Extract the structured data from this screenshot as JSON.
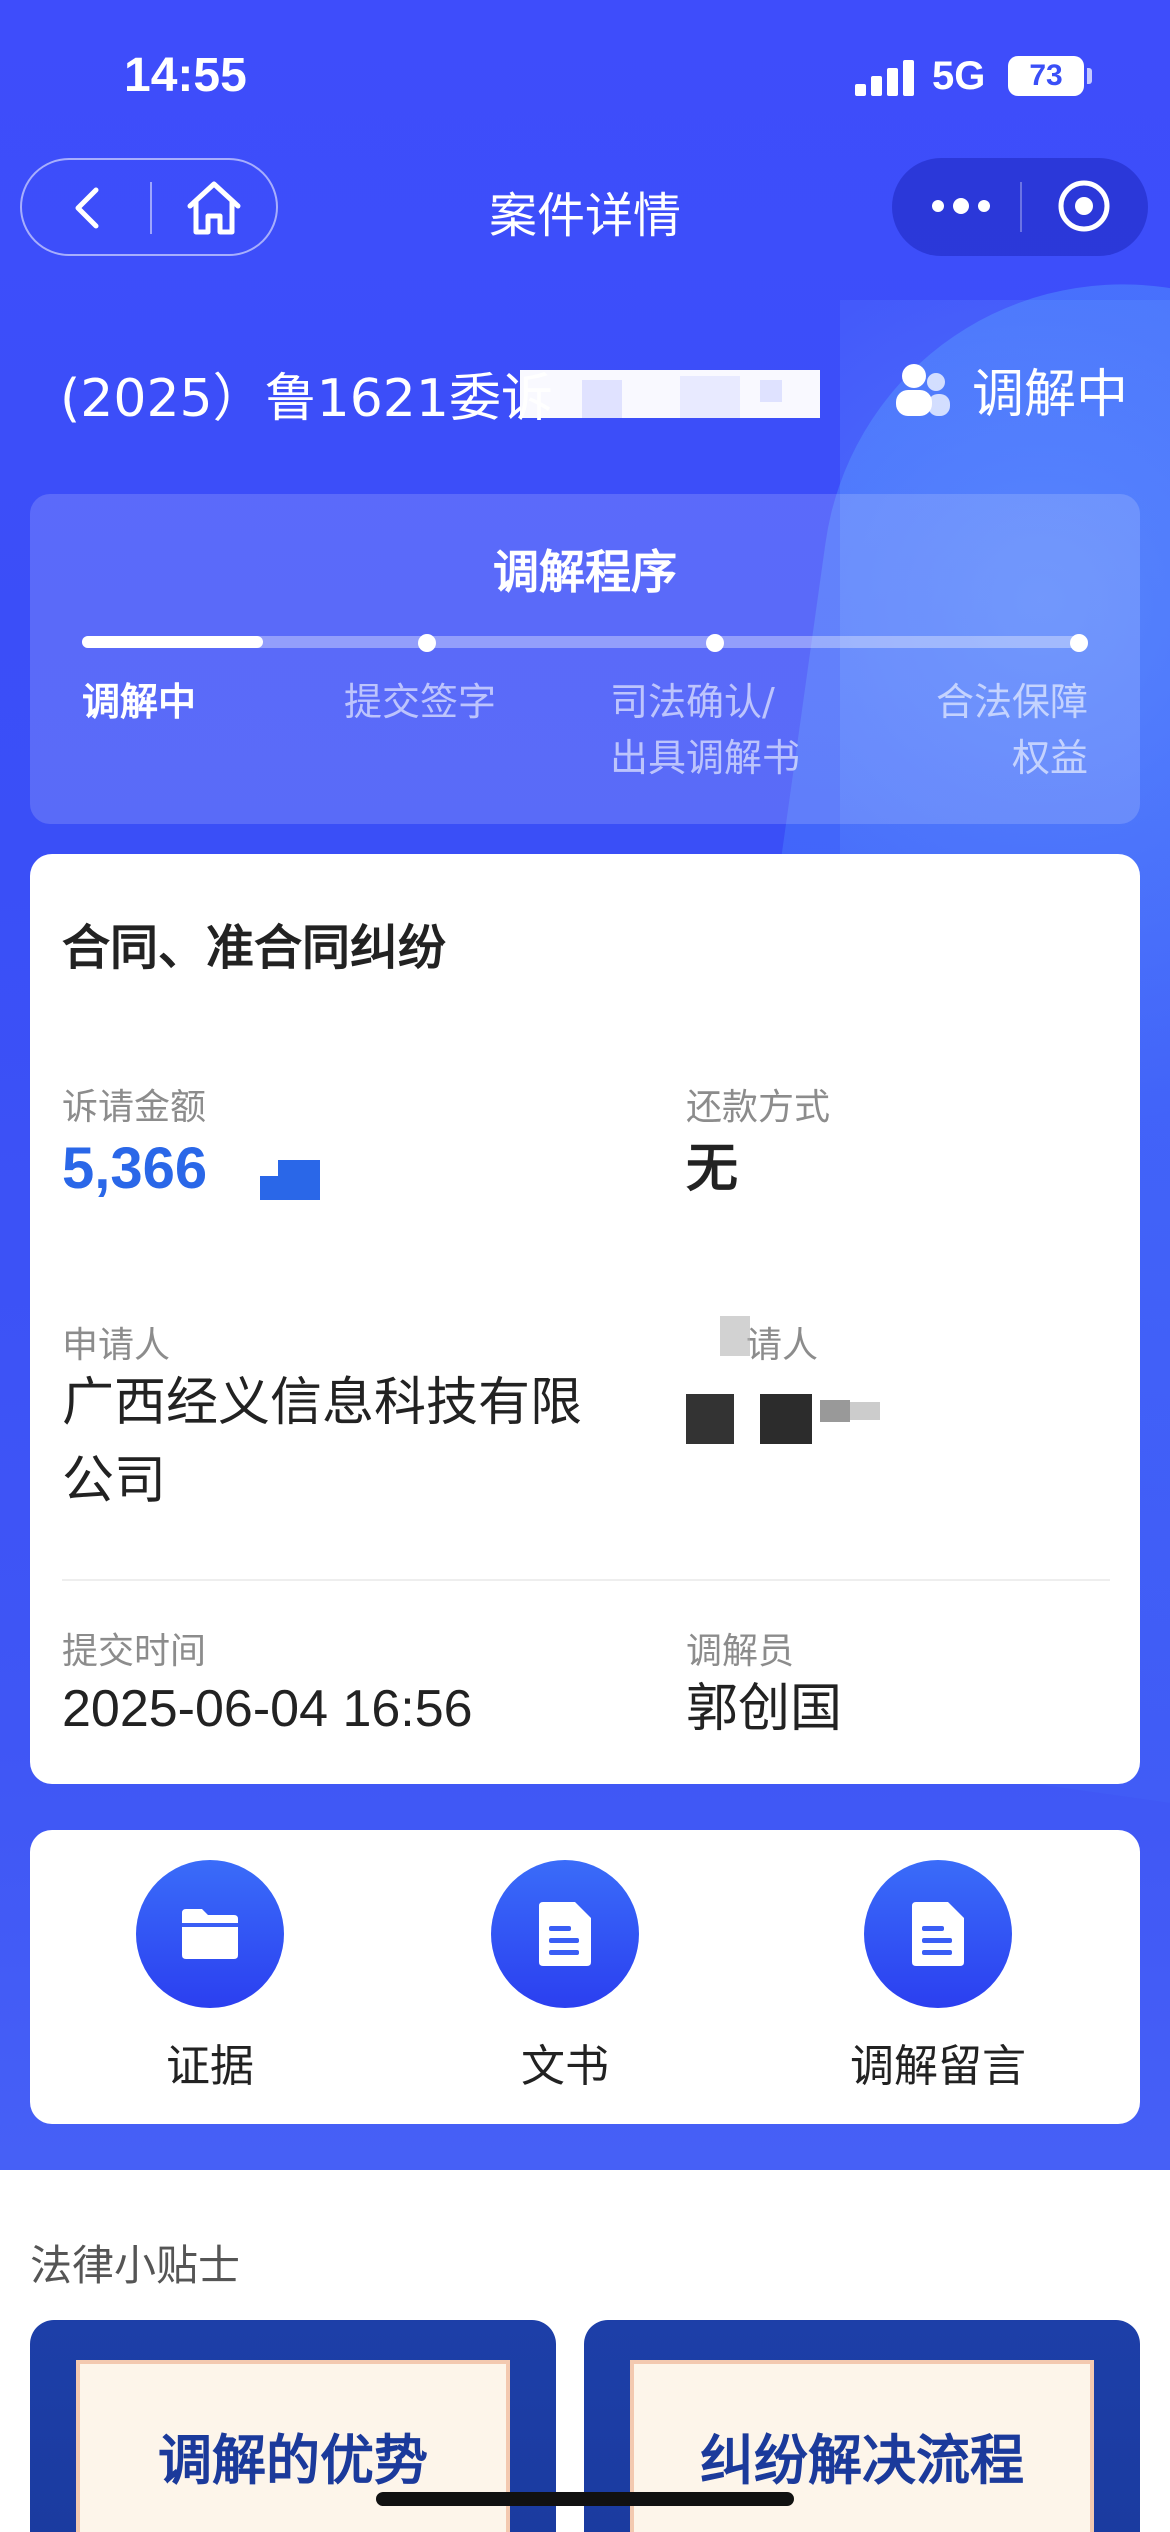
{
  "status_bar": {
    "time": "14:55",
    "network": "5G",
    "battery": "73"
  },
  "nav": {
    "title": "案件详情"
  },
  "case": {
    "number": "(2025）鲁1621委诉",
    "status": "调解中"
  },
  "process": {
    "title": "调解程序",
    "progress": 0.18,
    "steps": [
      {
        "line1": "调解中",
        "line2": ""
      },
      {
        "line1": "提交签字",
        "line2": ""
      },
      {
        "line1": "司法确认/",
        "line2": "出具调解书"
      },
      {
        "line1": "合法保障",
        "line2": "权益"
      }
    ]
  },
  "info": {
    "dispute_type": "合同、准合同纠纷",
    "amount_label": "诉请金额",
    "amount_value": "5,366",
    "repay_label": "还款方式",
    "repay_value": "无",
    "applicant_label": "申请人",
    "applicant_value_line1": "广西经义信息科技有限",
    "applicant_value_line2": "公司",
    "respondent_label": "请人",
    "submit_label": "提交时间",
    "submit_value": "2025-06-04 16:56",
    "mediator_label": "调解员",
    "mediator_value": "郭创国"
  },
  "actions": [
    {
      "label": "证据",
      "icon": "folder-icon"
    },
    {
      "label": "文书",
      "icon": "document-icon"
    },
    {
      "label": "调解留言",
      "icon": "document-icon"
    }
  ],
  "tips": {
    "title": "法律小贴士",
    "cards": [
      {
        "title": "调解的优势"
      },
      {
        "title": "纠纷解决流程"
      }
    ]
  },
  "colors": {
    "primary": "#3a4ff7",
    "amount": "#2a67e8"
  }
}
